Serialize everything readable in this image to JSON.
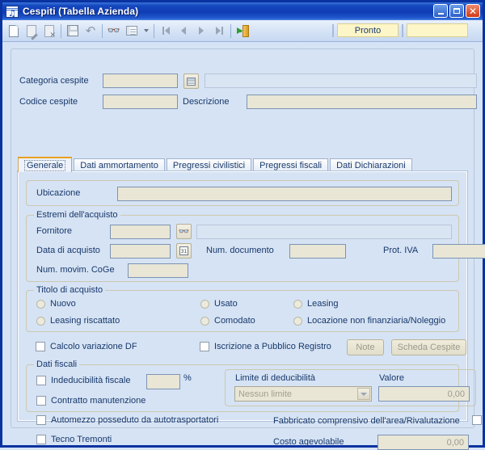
{
  "window": {
    "title": "Cespiti (Tabella Azienda)",
    "icon": "table-music-icon",
    "minimize": "minimize-icon",
    "maximize": "maximize-icon",
    "close": "close-icon"
  },
  "toolbar": {
    "icons": [
      "new-document-icon",
      "edit-document-icon",
      "delete-document-icon",
      "save-icon",
      "undo-icon",
      "find-icon",
      "list-view-icon",
      "dropdown-caret-icon",
      "first-record-icon",
      "previous-record-icon",
      "next-record-icon",
      "last-record-icon",
      "exit-icon"
    ],
    "status_text": "Pronto",
    "status_extra": ""
  },
  "header": {
    "categoria_label": "Categoria cespite",
    "categoria_value": "",
    "categoria_lookup_icon": "grid-lookup-icon",
    "categoria_desc_value": "",
    "codice_label": "Codice cespite",
    "codice_value": "",
    "descrizione_label": "Descrizione",
    "descrizione_value": ""
  },
  "tabs": [
    {
      "label": "Generale",
      "active": true
    },
    {
      "label": "Dati ammortamento",
      "active": false
    },
    {
      "label": "Pregressi civilistici",
      "active": false
    },
    {
      "label": "Pregressi fiscali",
      "active": false
    },
    {
      "label": "Dati Dichiarazioni",
      "active": false
    }
  ],
  "generale": {
    "ubicazione": {
      "label": "Ubicazione",
      "value": ""
    },
    "estremi": {
      "title": "Estremi dell'acquisto",
      "fornitore_label": "Fornitore",
      "fornitore_value": "",
      "fornitore_lookup_icon": "binoculars-icon",
      "fornitore_desc_value": "",
      "data_label": "Data di acquisto",
      "data_value": "",
      "data_picker_icon": "calendar-icon",
      "num_documento_label": "Num. documento",
      "num_documento_value": "",
      "prot_iva_label": "Prot. IVA",
      "prot_iva_value": "",
      "num_movim_label": "Num. movim. CoGe",
      "num_movim_value": ""
    },
    "titolo": {
      "title": "Titolo di acquisto",
      "options": [
        {
          "label": "Nuovo",
          "checked": false
        },
        {
          "label": "Usato",
          "checked": false
        },
        {
          "label": "Leasing",
          "checked": false
        },
        {
          "label": "Leasing riscattato",
          "checked": false
        },
        {
          "label": "Comodato",
          "checked": false
        },
        {
          "label": "Locazione non finanziaria/Noleggio",
          "checked": false
        }
      ]
    },
    "middle": {
      "calcolo_variazione_df": {
        "label": "Calcolo variazione DF",
        "checked": false
      },
      "iscrizione_pubblico_registro": {
        "label": "Iscrizione a Pubblico Registro",
        "checked": false
      },
      "note_button": "Note",
      "scheda_cespite_button": "Scheda Cespite"
    },
    "dati_fiscali": {
      "title": "Dati fiscali",
      "indeducibilita_label": "Indeducibilità fiscale",
      "indeducibilita_checked": false,
      "indeducibilita_value": "",
      "percent_symbol": "%",
      "contratto_label": "Contratto manutenzione",
      "contratto_checked": false,
      "automezzo_label": "Automezzo posseduto da autotrasportatori",
      "automezzo_checked": false,
      "tecno_label": "Tecno Tremonti",
      "tecno_checked": false,
      "limite_title": "Limite di deducibilità",
      "limite_value": "Nessun limite",
      "valore_label": "Valore",
      "valore_value": "0,00",
      "fabbricato_label": "Fabbricato comprensivo dell'area/Rivalutazione",
      "fabbricato_checked": false,
      "costo_label": "Costo agevolabile",
      "costo_value": "0,00"
    }
  }
}
